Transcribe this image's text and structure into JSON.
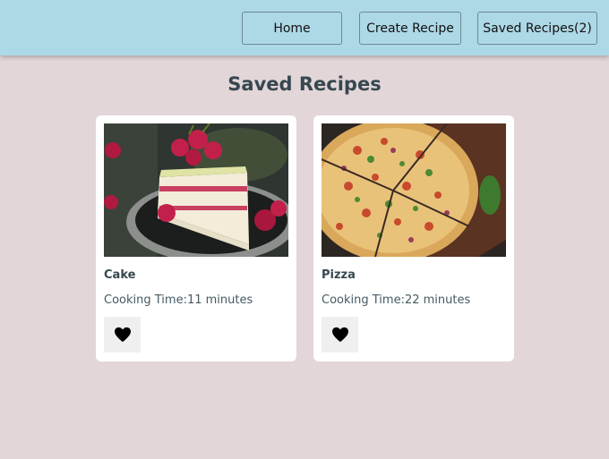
{
  "nav": {
    "home_label": "Home",
    "create_label": "Create Recipe",
    "saved_label": "Saved Recipes(2)"
  },
  "page": {
    "title": "Saved Recipes"
  },
  "recipes": [
    {
      "name": "Cake",
      "cooking_time": "Cooking Time:11 minutes",
      "image": "cake-photo",
      "favorite_icon": "heart-icon"
    },
    {
      "name": "Pizza",
      "cooking_time": "Cooking Time:22 minutes",
      "image": "pizza-photo",
      "favorite_icon": "heart-icon"
    }
  ],
  "colors": {
    "navbar": "#add8e6",
    "background": "#e2d6d8",
    "title": "#37474f",
    "card": "#ffffff"
  }
}
